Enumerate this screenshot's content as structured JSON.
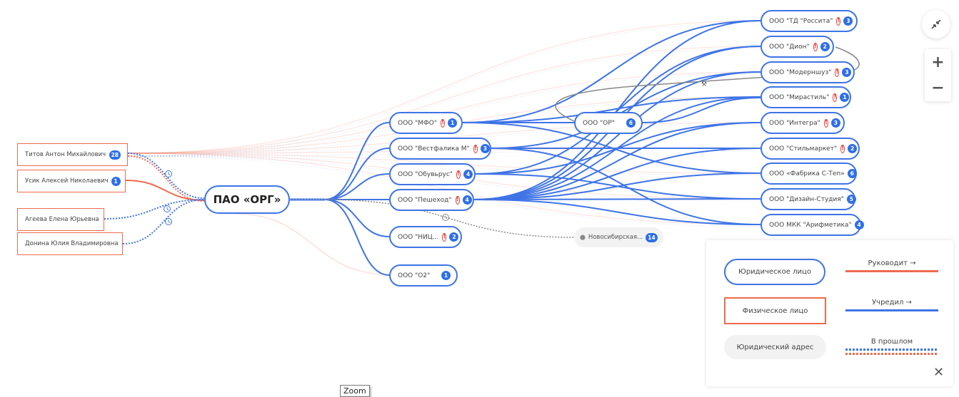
{
  "colors": {
    "founded": "#3f74e6",
    "manages": "#ef6b4f",
    "past_blue": "#3f74e6",
    "past_red": "#ef6b4f",
    "address_link": "#888888",
    "warning": "#e53935",
    "badge": "#2f6fe8"
  },
  "center": {
    "label": "ПАО «ОРГ»"
  },
  "persons": [
    {
      "id": "p1",
      "label": "Титов Антон Михайлович",
      "badge": "28"
    },
    {
      "id": "p2",
      "label": "Усик Алексей Николаевич",
      "badge": "1"
    },
    {
      "id": "p3",
      "label": "Агеева Елена Юрьевна",
      "badge": null
    },
    {
      "id": "p4",
      "label": "Донина Юлия Владимировна",
      "badge": null
    }
  ],
  "level1": [
    {
      "id": "c1",
      "label": "ООО \"МФО\"",
      "warning": true,
      "badge": "1"
    },
    {
      "id": "c2",
      "label": "ООО \"Вестфалика М\"",
      "warning": true,
      "badge": "3"
    },
    {
      "id": "c3",
      "label": "ООО \"Обувьрус\"",
      "warning": true,
      "badge": "4"
    },
    {
      "id": "c4",
      "label": "ООО \"Пешеход\"",
      "warning": true,
      "badge": "4"
    },
    {
      "id": "c5",
      "label": "ООО \"НИЦ...",
      "warning": true,
      "badge": "2"
    },
    {
      "id": "c6",
      "label": "ООО \"О2\"",
      "warning": false,
      "badge": "1"
    }
  ],
  "mid": {
    "id": "or",
    "label": "ООО \"ОР\"",
    "warning": false,
    "badge": "6"
  },
  "address": {
    "label": "Новосибирская...",
    "badge": "14",
    "icon": "map-pin-icon"
  },
  "level2": [
    {
      "id": "r1",
      "label": "ООО \"ТД \"Россита\"",
      "warning": true,
      "badge": "3"
    },
    {
      "id": "r2",
      "label": "ООО \"Дион\"",
      "warning": true,
      "badge": "2"
    },
    {
      "id": "r3",
      "label": "ООО \"Модерншуз\"",
      "warning": true,
      "badge": "3"
    },
    {
      "id": "r4",
      "label": "ООО \"Мирастиль\"",
      "warning": true,
      "badge": "1"
    },
    {
      "id": "r5",
      "label": "ООО \"Интегра\"",
      "warning": true,
      "badge": "3"
    },
    {
      "id": "r6",
      "label": "ООО \"Стильмаркет\"",
      "warning": true,
      "badge": "2"
    },
    {
      "id": "r7",
      "label": "ООО «Фабрика С-Теп»",
      "warning": false,
      "badge": "6"
    },
    {
      "id": "r8",
      "label": "ООО \"Дизайн-Студия\"",
      "warning": false,
      "badge": "5"
    },
    {
      "id": "r9",
      "label": "ООО МКК \"Арифметика\"",
      "warning": false,
      "badge": "4"
    }
  ],
  "controls": {
    "collapse_icon": "collapse-arrows-icon",
    "zoom_in": "+",
    "zoom_out": "−"
  },
  "legend": {
    "legal_entity": "Юридическое лицо",
    "natural_person": "Физическое лицо",
    "legal_address": "Юридический адрес",
    "manages": "Руководит →",
    "founded": "Учредил →",
    "past": "В прошлом",
    "close": "✕"
  },
  "tooltip": "Zoom"
}
